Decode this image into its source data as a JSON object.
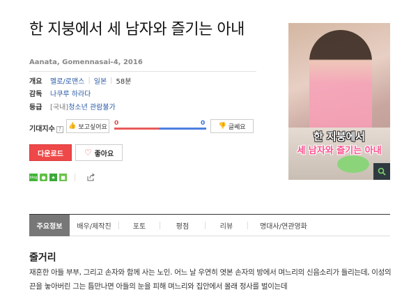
{
  "movie": {
    "title": "한 지붕에서 세 남자와 즐기는 아내",
    "subtitle": "Aanata, Gomennasai-4, 2016"
  },
  "info": {
    "overview_label": "개요",
    "genre": "멜로/로맨스",
    "country": "일본",
    "runtime": "58분",
    "director_label": "감독",
    "director": "나쿠루 하라다",
    "rating_label": "등급",
    "rating_prefix": "[국내]",
    "rating": "청소년 관람불가"
  },
  "expectation": {
    "label": "기대지수",
    "help": "?",
    "like_label": "보고싶어요",
    "dislike_label": "글쎄요",
    "like_count": "0",
    "dislike_count": "0",
    "like_fraction": 0.5
  },
  "actions": {
    "download": "다운로드",
    "favorite": "좋아요"
  },
  "share": {
    "blog": "blog"
  },
  "poster": {
    "line1": "한 지붕에서",
    "line2": "세 남자와 즐기는 아내"
  },
  "tabs": [
    {
      "label": "주요정보",
      "active": true
    },
    {
      "label": "배우/제작진",
      "active": false
    },
    {
      "label": "포토",
      "active": false
    },
    {
      "label": "평점",
      "active": false
    },
    {
      "label": "리뷰",
      "active": false
    },
    {
      "label": "명대사/연관영화",
      "active": false
    }
  ],
  "synopsis": {
    "title": "줄거리",
    "text": "재혼한 아들 부부, 그리고 손자와 함께 사는 노인. 어느 날 우연히 엿본 손자의 방에서 며느리의 신음소리가 들리는데, 이성의 끈을 놓아버린 그는 틈만나면 아들의 눈을 피해 며느리와 집안에서 몰래 정사를 벌이는데"
  },
  "colors": {
    "accent_red": "#ee4848",
    "link_blue": "#2a5aa6",
    "like_red": "#ea5a5a",
    "dislike_blue": "#4d7fe0"
  }
}
